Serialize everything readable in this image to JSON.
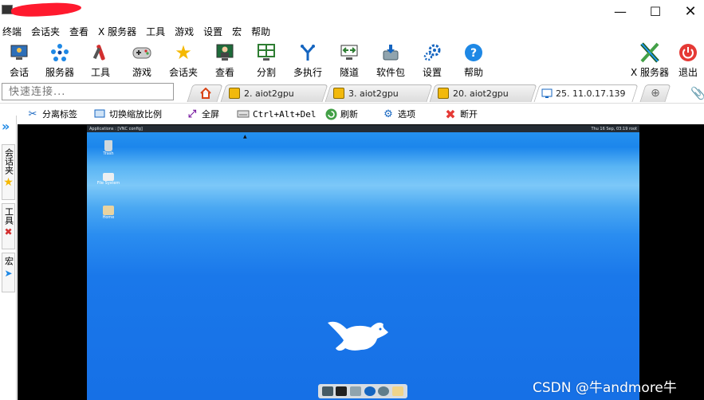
{
  "menu": [
    "终端",
    "会话夹",
    "查看",
    "X 服务器",
    "工具",
    "游戏",
    "设置",
    "宏",
    "帮助"
  ],
  "toolbar": {
    "items": [
      {
        "label": "会话",
        "icon": "session-monitor-icon"
      },
      {
        "label": "服务器",
        "icon": "server-dots-icon"
      },
      {
        "label": "工具",
        "icon": "tools-icon"
      },
      {
        "label": "游戏",
        "icon": "gamepad-icon"
      },
      {
        "label": "会话夹",
        "icon": "star-icon"
      },
      {
        "label": "查看",
        "icon": "view-person-icon"
      },
      {
        "label": "分割",
        "icon": "split-screen-icon"
      },
      {
        "label": "多执行",
        "icon": "multi-exec-fork-icon"
      },
      {
        "label": "隧道",
        "icon": "tunnel-icon"
      },
      {
        "label": "软件包",
        "icon": "package-icon"
      },
      {
        "label": "设置",
        "icon": "settings-gears-icon"
      },
      {
        "label": "帮助",
        "icon": "help-icon"
      }
    ],
    "xserver_label": "X 服务器",
    "exit_label": "退出"
  },
  "quick_connect_placeholder": "快速连接...",
  "tabs": [
    {
      "label": "2. aiot2gpu"
    },
    {
      "label": "3. aiot2gpu"
    },
    {
      "label": "20. aiot2gpu"
    },
    {
      "label": "25. 11.0.17.139"
    }
  ],
  "subtoolbar": [
    "分离标签",
    "切换缩放比例",
    "全屏",
    "Ctrl+Alt+Del",
    "刷新",
    "选项",
    "断开"
  ],
  "sidebar": [
    "会话夹",
    "工具",
    "宏"
  ],
  "vnc": {
    "top_left": "Applications : [VNC config]",
    "top_right": "Thu 16 Sep, 03:19  root",
    "desktop_icons": [
      "Trash",
      "File System",
      "Home"
    ]
  },
  "watermark": "CSDN @牛andmore牛",
  "colors": {
    "accent": "#1a78ea",
    "close_red": "#e53935"
  }
}
